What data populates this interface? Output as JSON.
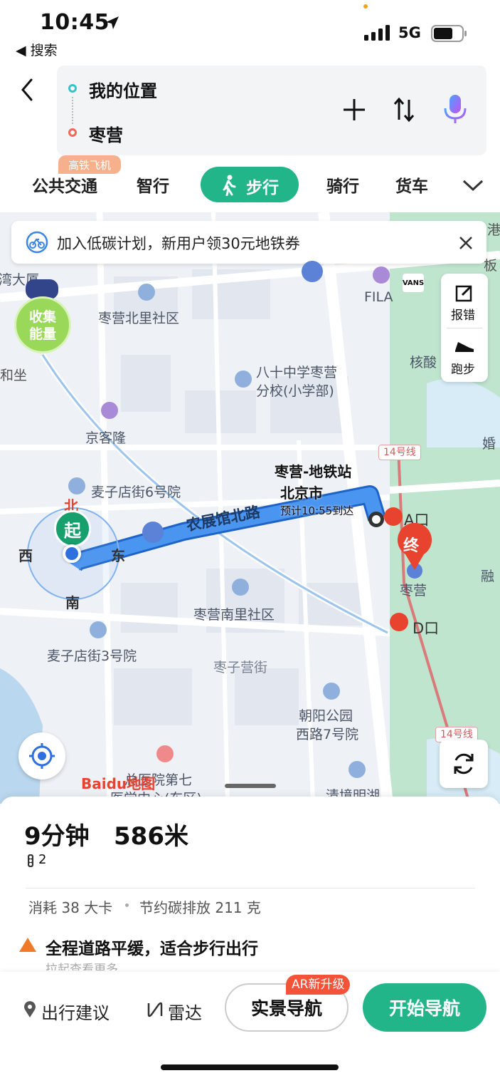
{
  "status_bar": {
    "time": "10:45",
    "back_label": "◀ 搜索",
    "network": "5G"
  },
  "route": {
    "origin": "我的位置",
    "destination": "枣营"
  },
  "tabs": [
    {
      "label": "公共交通",
      "badge": "高铁飞机"
    },
    {
      "label": "智行"
    },
    {
      "label": "步行",
      "active": true
    },
    {
      "label": "骑行"
    },
    {
      "label": "货车"
    }
  ],
  "banner": {
    "text": "加入低碳计划，新用户领30元地铁券"
  },
  "map": {
    "side_tools": {
      "report": "报错",
      "run": "跑步"
    },
    "energy_bubble": "收集\n能量",
    "compass": {
      "north": "北",
      "south": "南",
      "east": "东",
      "west": "西"
    },
    "start_marker": "起",
    "end_marker": "终",
    "road_label": "农展馆北路",
    "callout": {
      "title": "枣营-地铁站",
      "subtitle": "北京市",
      "eta": "预计10:55到达"
    },
    "labels": {
      "north_community": "枣营北里社区",
      "school_1": "八十中学枣营",
      "school_2": "分校(小学部)",
      "jingkelong": "京客隆",
      "maizidian6": "麦子店街6号院",
      "south_community": "枣营南里社区",
      "maizidian3": "麦子店街3号院",
      "zaoziying_st": "枣子营街",
      "park_1": "朝阳公园",
      "park_2": "西路7号院",
      "hospital_1": "总医院第七",
      "hospital_2": "医学中心(东区)",
      "qingjing": "清境明湖",
      "fila": "FILA",
      "vans": "VANS",
      "hesuan": "核酸",
      "hun": "婚",
      "rong": "融",
      "line14": "14号线",
      "exit_a": "A口",
      "exit_d": "D口",
      "station": "枣营",
      "he_zuo": "和坐",
      "wan_da": "湾大厦",
      "gang": "港",
      "ban": "板",
      "baidu_logo": "Baidu地图"
    }
  },
  "summary": {
    "duration": "9分钟",
    "distance": "586米",
    "lights": "2",
    "calories": "消耗 38 大卡",
    "carbon": "节约碳排放 211 克",
    "tip": "全程道路平缓，适合步行出行",
    "more": "拉起查看更多"
  },
  "bottom_bar": {
    "advice": "出行建议",
    "radar": "雷达",
    "ar_nav": "实景导航",
    "ar_badge": "AR新升级",
    "start_nav": "开始导航"
  },
  "colors": {
    "accent": "#22b58a",
    "route": "#3d86e8",
    "end_marker": "#e8432f"
  }
}
